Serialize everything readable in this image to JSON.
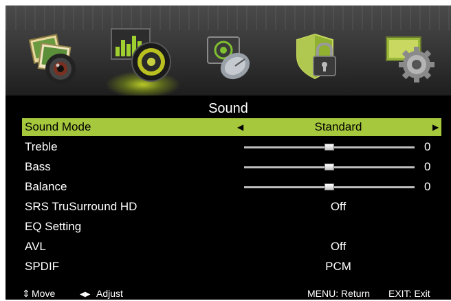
{
  "menu_icons": [
    {
      "name": "picture-icon",
      "selected": false
    },
    {
      "name": "sound-icon",
      "selected": true
    },
    {
      "name": "channel-icon",
      "selected": false
    },
    {
      "name": "lock-icon",
      "selected": false
    },
    {
      "name": "setup-icon",
      "selected": false
    }
  ],
  "title": "Sound",
  "rows": [
    {
      "label": "Sound Mode",
      "value": "Standard",
      "selected": true
    },
    {
      "label": "Treble",
      "slider": 50,
      "number": "0"
    },
    {
      "label": "Bass",
      "slider": 50,
      "number": "0"
    },
    {
      "label": "Balance",
      "slider": 50,
      "number": "0"
    },
    {
      "label": "SRS TruSurround HD",
      "value": "Off"
    },
    {
      "label": "EQ Setting",
      "value": ""
    },
    {
      "label": "AVL",
      "value": "Off"
    },
    {
      "label": "SPDIF",
      "value": "PCM"
    }
  ],
  "arrows": {
    "left": "◀",
    "right": "▶"
  },
  "footer": {
    "move_icon": "⇕",
    "move": "Move",
    "adjust_icon": "◀▶",
    "adjust": "Adjust",
    "menu": "MENU: Return",
    "exit": "EXIT: Exit"
  },
  "colors": {
    "highlight": "#a6c83c",
    "background": "#000000"
  }
}
